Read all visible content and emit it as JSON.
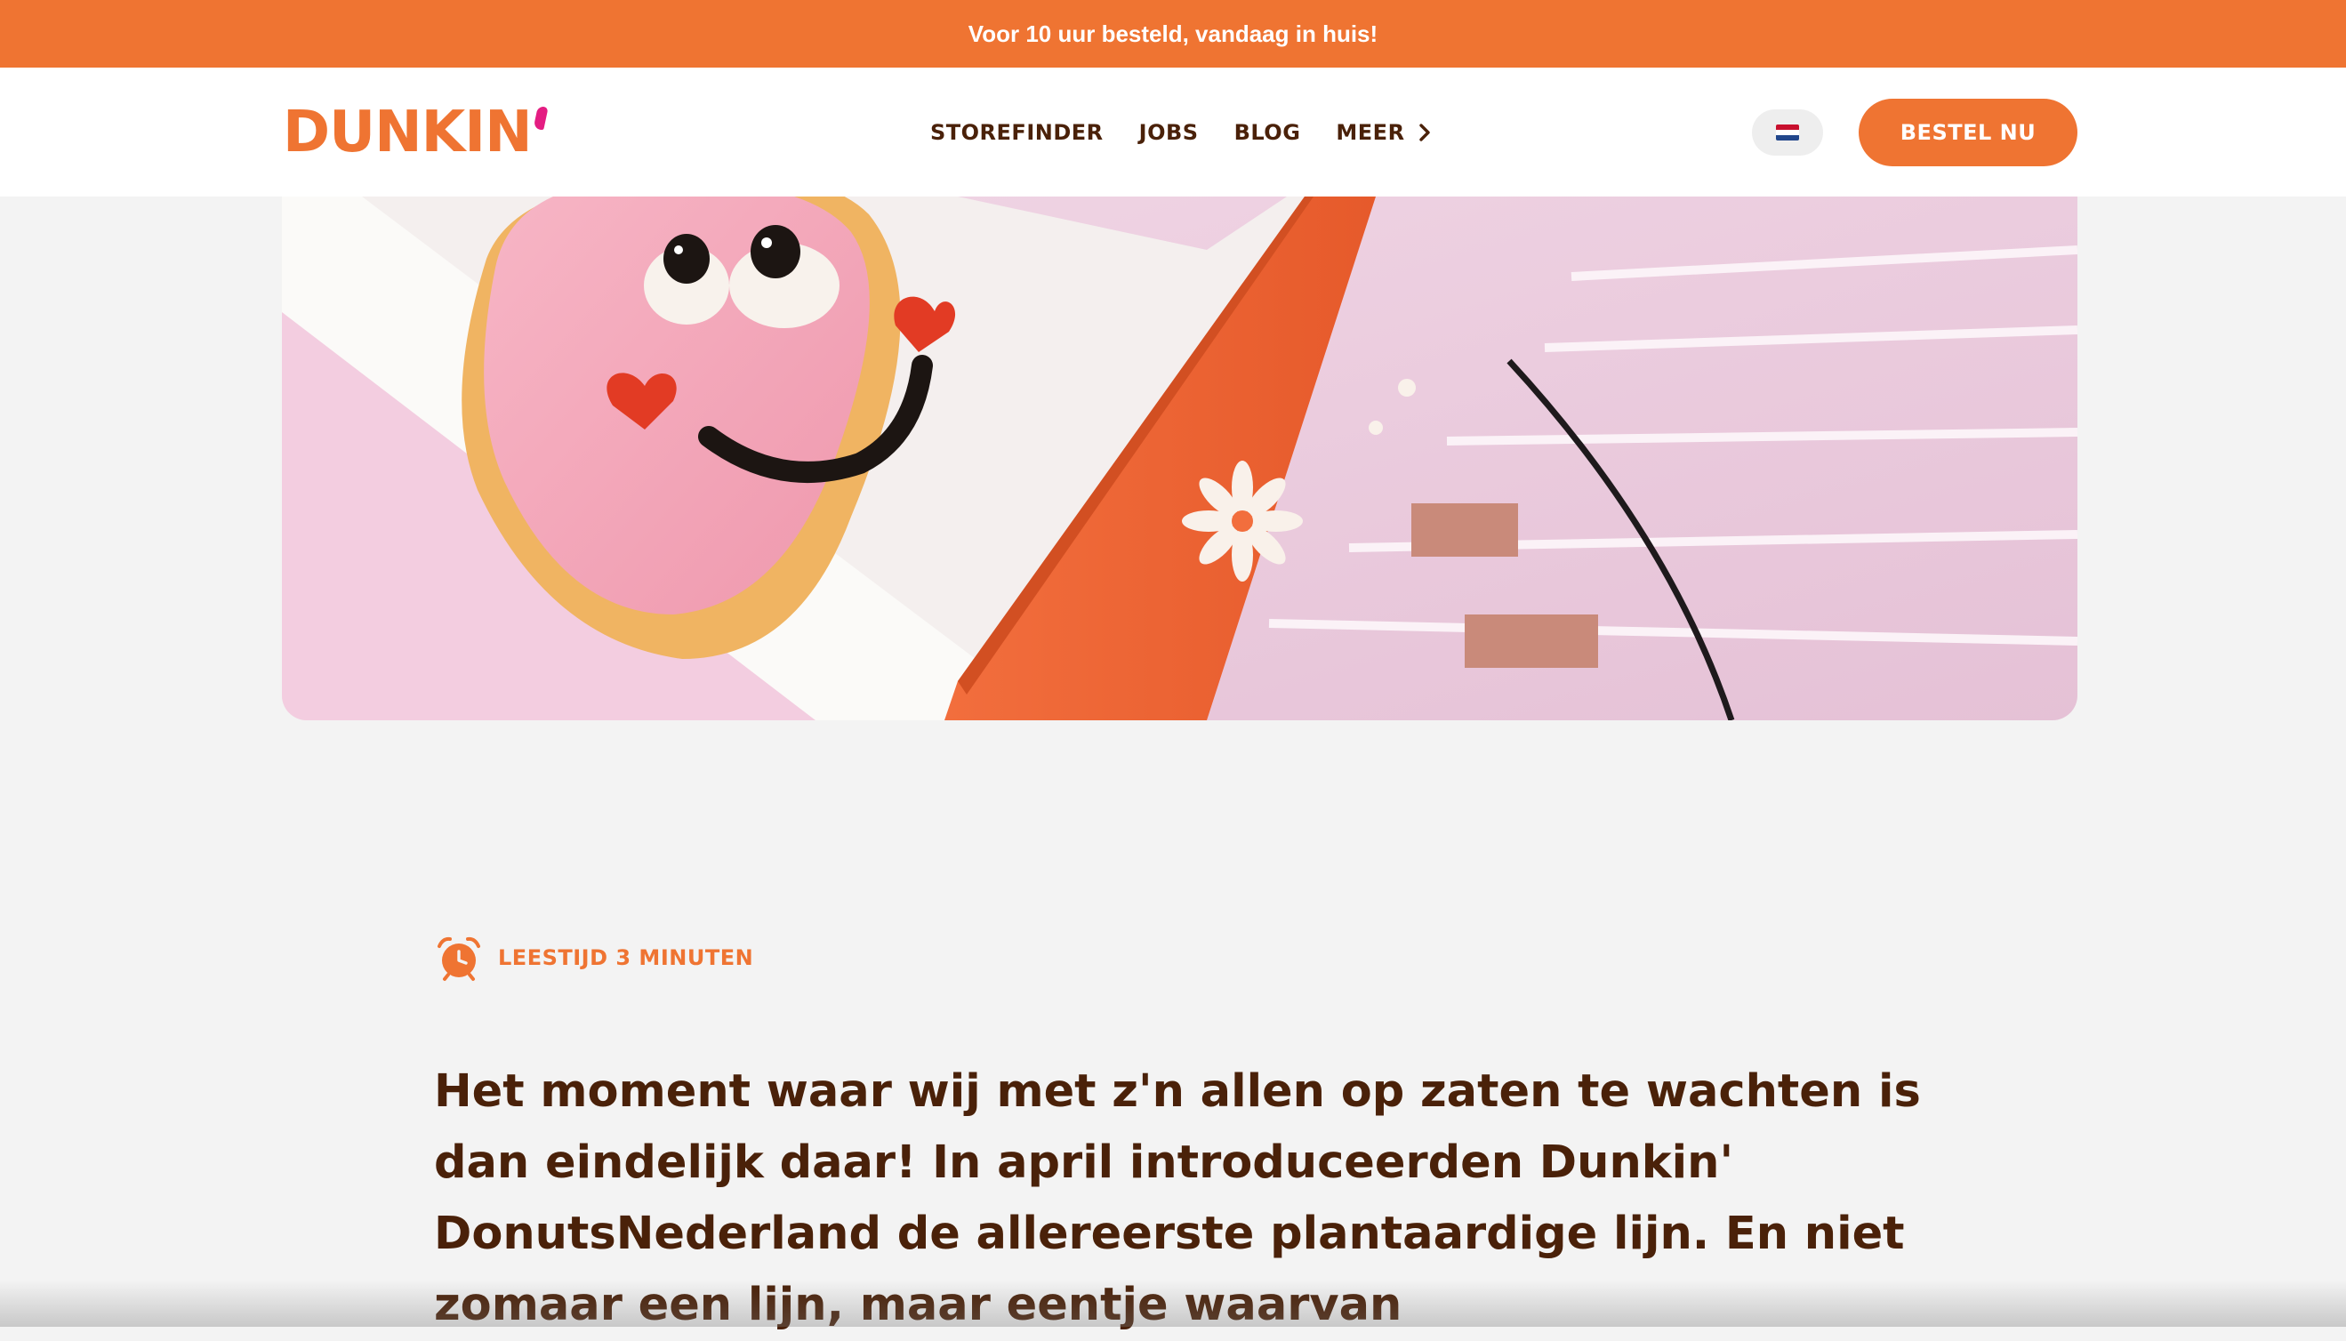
{
  "promo": {
    "text": "Voor 10 uur besteld, vandaag in huis!"
  },
  "header": {
    "logo_text": "DUNKIN",
    "nav": [
      {
        "label": "STOREFINDER"
      },
      {
        "label": "JOBS"
      },
      {
        "label": "BLOG"
      },
      {
        "label": "MEER"
      }
    ],
    "language_icon": "dutch-flag-icon",
    "order_button": "BESTEL NU"
  },
  "colors": {
    "brand_orange": "#ef7432",
    "brand_pink": "#e41d82",
    "text_brown": "#4a2109",
    "page_background": "#f3f3f3"
  },
  "hero": {
    "image_subject": "heart-shaped pink donut with smiley face in an orange box"
  },
  "article": {
    "reading_time_icon": "alarm-clock-icon",
    "reading_time": "LEESTIJD 3 MINUTEN",
    "intro": "Het moment waar wij met z'n allen op zaten te wachten is dan eindelijk daar! In april introduceerden Dunkin' DonutsNederland de allereerste plantaardige lijn. En niet zomaar een lijn, maar eentje waarvan"
  }
}
